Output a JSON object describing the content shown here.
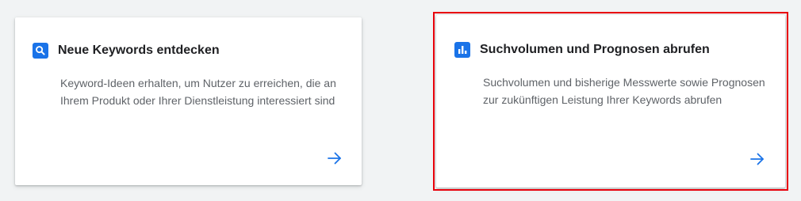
{
  "cards": [
    {
      "title": "Neue Keywords entdecken",
      "description": "Keyword-Ideen erhalten, um Nutzer zu erreichen, die an Ihrem Produkt oder Ihrer Dienstleistung interessiert sind",
      "icon": "search-icon",
      "action_icon": "arrow-right-icon"
    },
    {
      "title": "Suchvolumen und Prognosen abrufen",
      "description": "Suchvolumen und bisherige Messwerte sowie Prognosen zur zukünftigen Leistung Ihrer Keywords abrufen",
      "icon": "bar-chart-icon",
      "action_icon": "arrow-right-icon"
    }
  ],
  "colors": {
    "accent": "#1a73e8",
    "highlight_border": "#e8000b",
    "background": "#f1f3f4",
    "title_text": "#202124",
    "body_text": "#5f6368"
  }
}
